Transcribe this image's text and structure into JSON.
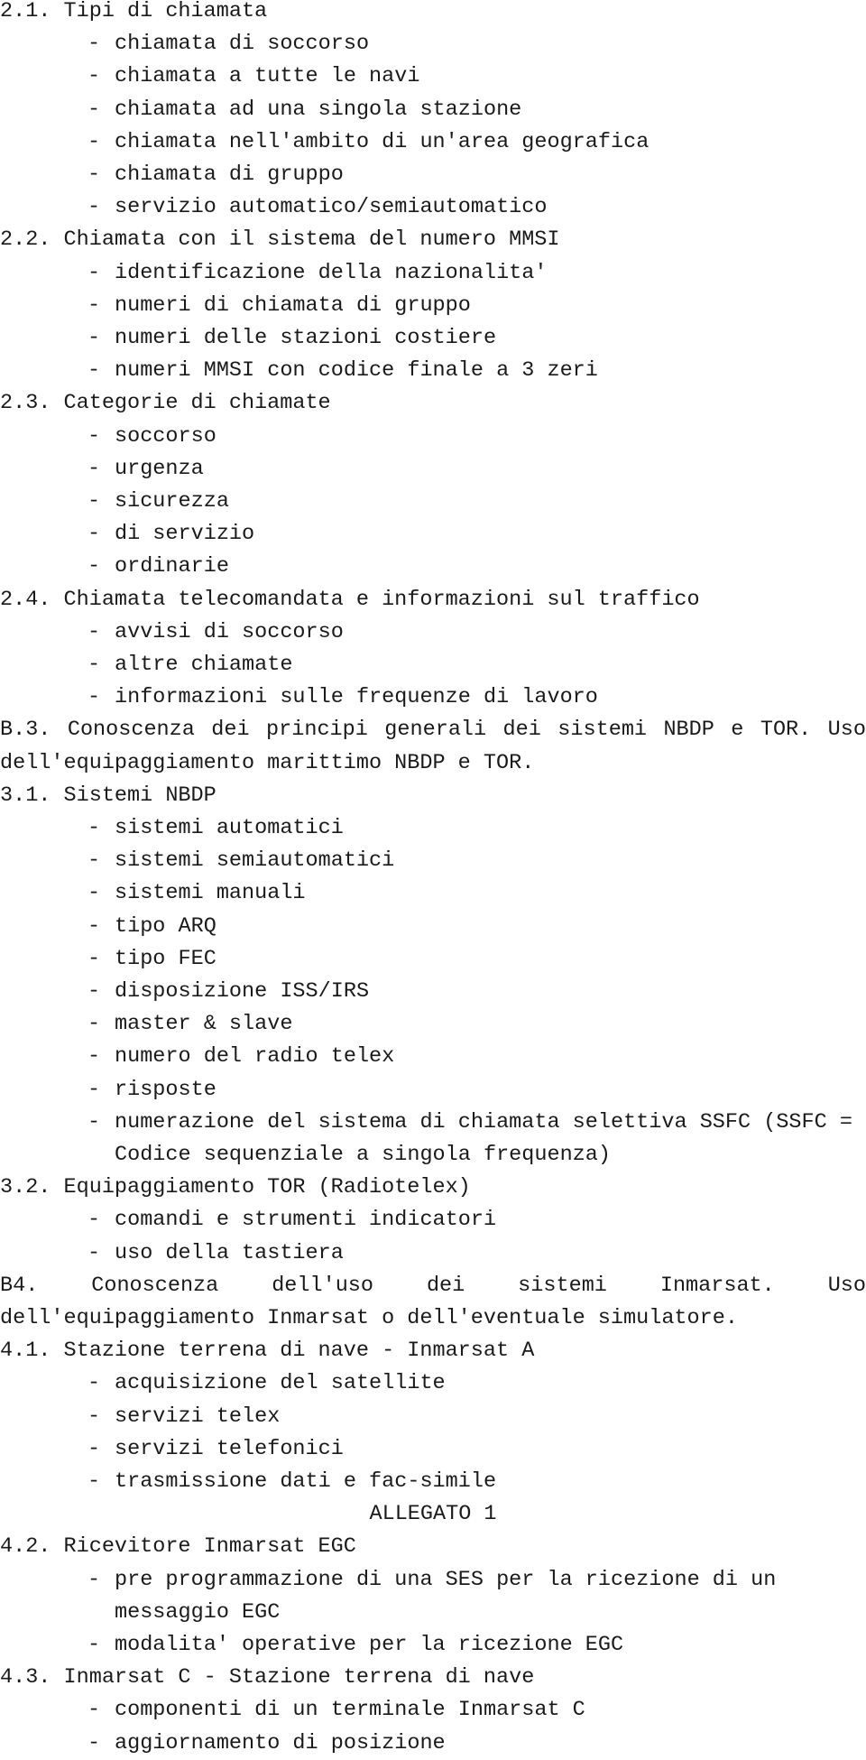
{
  "document": {
    "lines": [
      {
        "type": "heading",
        "text": "2.1. Tipi di chiamata"
      },
      {
        "type": "item",
        "text": "chiamata di soccorso"
      },
      {
        "type": "item",
        "text": "chiamata a tutte le navi"
      },
      {
        "type": "item",
        "text": "chiamata ad una singola stazione"
      },
      {
        "type": "item",
        "text": "chiamata nell'ambito di un'area geografica"
      },
      {
        "type": "item",
        "text": "chiamata di gruppo"
      },
      {
        "type": "item",
        "text": "servizio automatico/semiautomatico"
      },
      {
        "type": "heading",
        "text": "2.2. Chiamata con il sistema del numero MMSI"
      },
      {
        "type": "item",
        "text": "identificazione della nazionalita'"
      },
      {
        "type": "item",
        "text": "numeri di chiamata di gruppo"
      },
      {
        "type": "item",
        "text": "numeri delle stazioni costiere"
      },
      {
        "type": "item",
        "text": "numeri MMSI con codice finale a 3 zeri"
      },
      {
        "type": "heading",
        "text": "2.3. Categorie di chiamate"
      },
      {
        "type": "item",
        "text": "soccorso"
      },
      {
        "type": "item",
        "text": "urgenza"
      },
      {
        "type": "item",
        "text": "sicurezza"
      },
      {
        "type": "item",
        "text": "di servizio"
      },
      {
        "type": "item",
        "text": "ordinarie"
      },
      {
        "type": "heading",
        "text": "2.4. Chiamata telecomandata e informazioni sul traffico"
      },
      {
        "type": "item",
        "text": "avvisi di soccorso"
      },
      {
        "type": "item",
        "text": "altre chiamate"
      },
      {
        "type": "item",
        "text": "informazioni sulle frequenze di lavoro"
      },
      {
        "type": "justify",
        "text": "B.3. Conoscenza dei principi generali dei sistemi NBDP e TOR. Uso"
      },
      {
        "type": "heading",
        "text": "dell'equipaggiamento marittimo NBDP e TOR."
      },
      {
        "type": "heading",
        "text": "3.1. Sistemi NBDP"
      },
      {
        "type": "item",
        "text": "sistemi automatici"
      },
      {
        "type": "item",
        "text": "sistemi semiautomatici"
      },
      {
        "type": "item",
        "text": "sistemi manuali"
      },
      {
        "type": "item",
        "text": "tipo ARQ"
      },
      {
        "type": "item",
        "text": "tipo FEC"
      },
      {
        "type": "item",
        "text": "disposizione ISS/IRS"
      },
      {
        "type": "item",
        "text": "master & slave"
      },
      {
        "type": "item",
        "text": "numero del radio telex"
      },
      {
        "type": "item",
        "text": "risposte"
      },
      {
        "type": "item",
        "text": "numerazione del sistema di chiamata selettiva SSFC (SSFC ="
      },
      {
        "type": "cont",
        "text": "Codice sequenziale a singola frequenza)"
      },
      {
        "type": "heading",
        "text": "3.2. Equipaggiamento TOR (Radiotelex)"
      },
      {
        "type": "item",
        "text": "comandi e strumenti indicatori"
      },
      {
        "type": "item",
        "text": "uso della tastiera"
      },
      {
        "type": "justify",
        "text": "B4. Conoscenza dell'uso dei sistemi Inmarsat. Uso"
      },
      {
        "type": "heading",
        "text": "dell'equipaggiamento Inmarsat o dell'eventuale simulatore."
      },
      {
        "type": "heading",
        "text": "4.1. Stazione terrena di nave - Inmarsat A"
      },
      {
        "type": "item",
        "text": "acquisizione del satellite"
      },
      {
        "type": "item",
        "text": "servizi telex"
      },
      {
        "type": "item",
        "text": "servizi telefonici"
      },
      {
        "type": "item",
        "text": "trasmissione dati e fac-simile"
      },
      {
        "type": "center",
        "text": "ALLEGATO 1"
      },
      {
        "type": "heading",
        "text": "4.2. Ricevitore Inmarsat EGC"
      },
      {
        "type": "item",
        "text": "pre programmazione di una SES per la ricezione di un"
      },
      {
        "type": "cont",
        "text": "messaggio EGC"
      },
      {
        "type": "item",
        "text": "modalita' operative per la ricezione EGC"
      },
      {
        "type": "heading",
        "text": "4.3. Inmarsat C - Stazione terrena di nave"
      },
      {
        "type": "item",
        "text": "componenti di un terminale Inmarsat C"
      },
      {
        "type": "item",
        "text": "aggiornamento di posizione"
      }
    ],
    "bullet_glyph": "-"
  }
}
